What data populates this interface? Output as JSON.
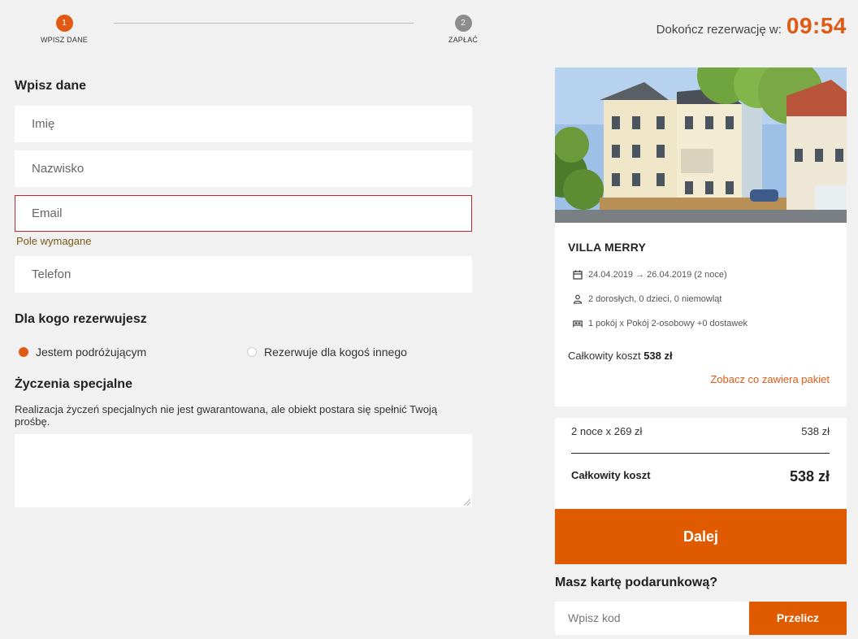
{
  "stepper": {
    "steps": [
      {
        "number": "1",
        "label": "WPISZ DANE",
        "state": "active"
      },
      {
        "number": "2",
        "label": "ZAPŁAĆ",
        "state": "inactive"
      }
    ]
  },
  "timer": {
    "label": "Dokończ rezerwację w:",
    "value": "09:54"
  },
  "form": {
    "section_title": "Wpisz dane",
    "first_name_placeholder": "Imię",
    "last_name_placeholder": "Nazwisko",
    "email_placeholder": "Email",
    "email_error": "Pole wymagane",
    "phone_placeholder": "Telefon"
  },
  "booking_for": {
    "title": "Dla kogo rezerwujesz",
    "options": [
      {
        "label": "Jestem podróżującym",
        "selected": true
      },
      {
        "label": "Rezerwuje dla kogoś innego",
        "selected": false
      }
    ]
  },
  "special_requests": {
    "title": "Życzenia specjalne",
    "note": "Realizacja życzeń specjalnych nie jest gwarantowana, ale obiekt postara się spełnić Twoją prośbę.",
    "value": ""
  },
  "hotel": {
    "name": "VILLA MERRY",
    "dates": "24.04.2019 → 26.04.2019 (2 noce)",
    "guests": "2 dorosłych, 0 dzieci, 0 niemowląt",
    "room": "1 pokój x Pokój 2-osobowy +0 dostawek",
    "total_label": "Całkowity koszt",
    "total_value": "538 zł",
    "package_link": "Zobacz co zawiera pakiet"
  },
  "summary": {
    "line_label": "2 noce x 269 zł",
    "line_value": "538 zł",
    "total_label": "Całkowity koszt",
    "total_value": "538 zł"
  },
  "next_button": "Dalej",
  "gift": {
    "title": "Masz kartę podarunkową?",
    "placeholder": "Wpisz kod",
    "button": "Przelicz"
  },
  "colors": {
    "accent": "#e05a14",
    "button": "#e05a00",
    "error": "#c0262d",
    "background": "#f1f1f1"
  },
  "icons": [
    "calendar-icon",
    "person-icon",
    "bed-icon"
  ]
}
